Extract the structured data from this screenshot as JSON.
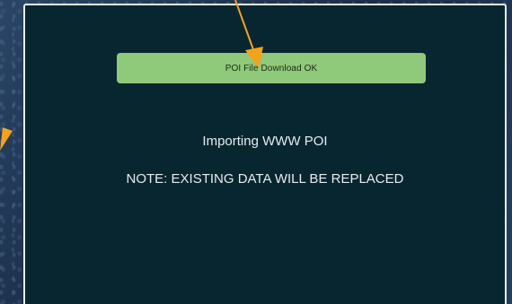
{
  "dialog": {
    "status_banner": "POI File Download OK",
    "title": "Importing WWW POI",
    "note": "NOTE: EXISTING DATA WILL BE REPLACED"
  },
  "colors": {
    "screen_background": "#082630",
    "banner_background": "#8fc97a",
    "annotation_arrow": "#f5a21b"
  },
  "annotations": [
    {
      "type": "arrow-icon",
      "target": "status-banner"
    },
    {
      "type": "arrow-icon",
      "target": "off-screen-left"
    }
  ]
}
